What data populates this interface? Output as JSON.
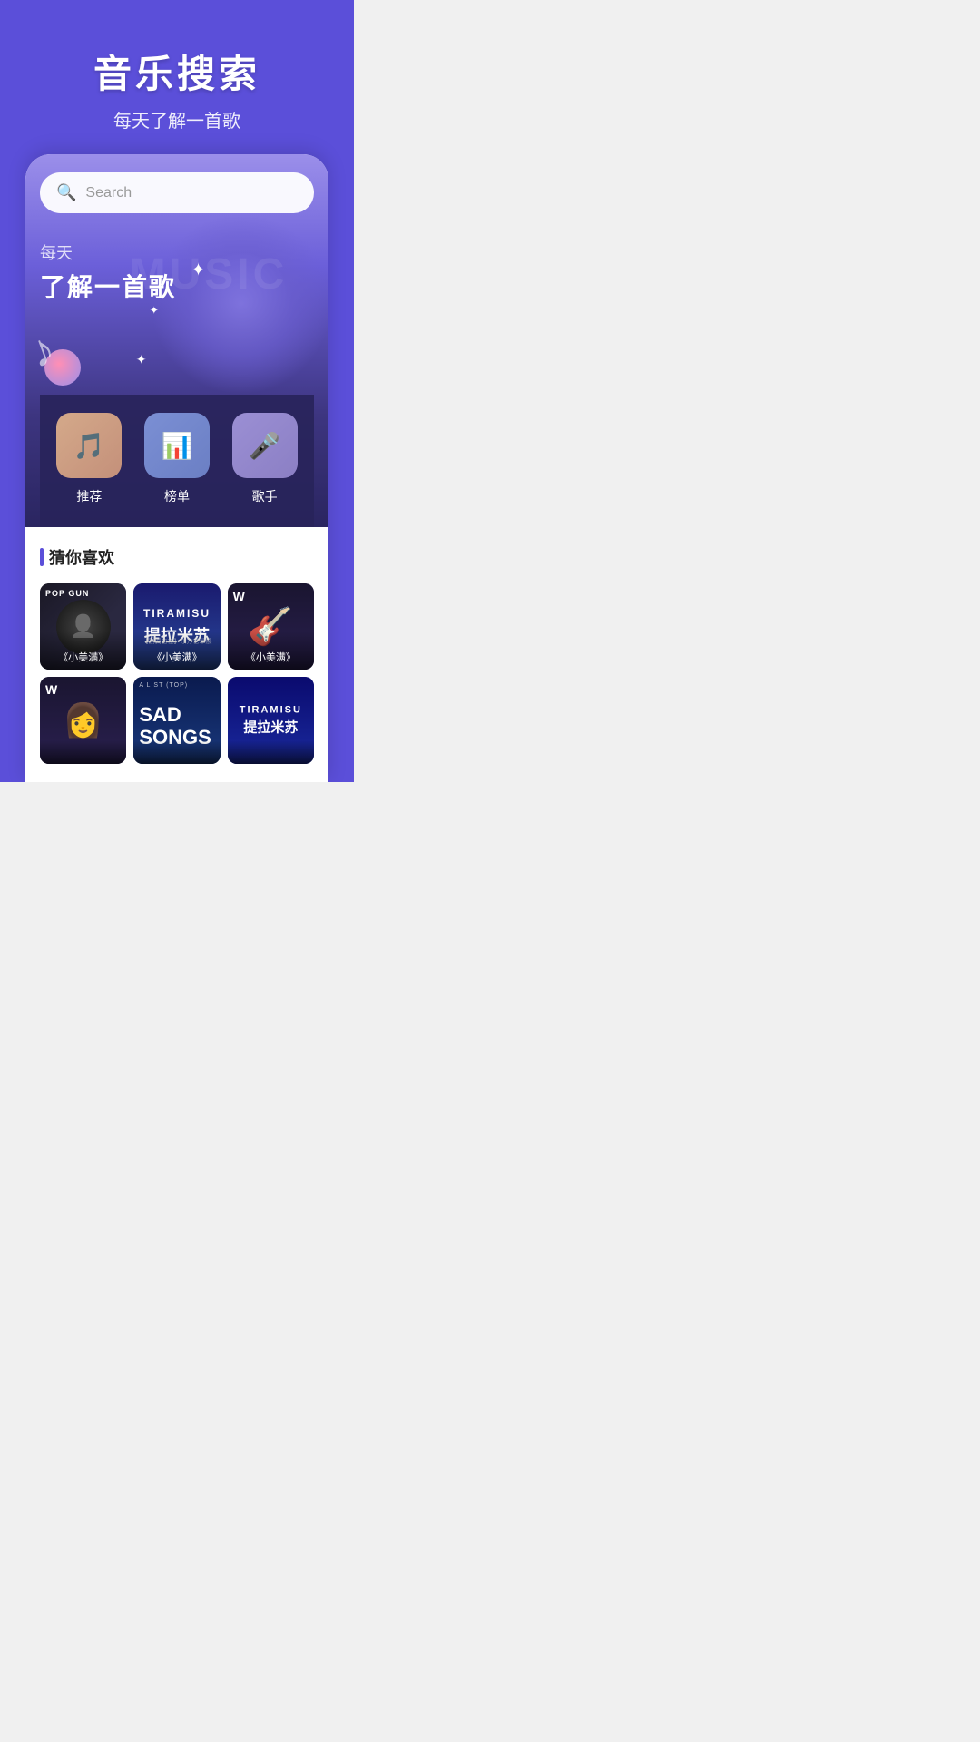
{
  "header": {
    "title": "音乐搜索",
    "subtitle": "每天了解一首歌"
  },
  "search": {
    "placeholder": "Search"
  },
  "banner": {
    "line1": "每天",
    "line2": "了解一首歌",
    "watermark": "MUSIC"
  },
  "quickAccess": {
    "items": [
      {
        "label": "推荐",
        "icon": "🎵"
      },
      {
        "label": "榜单",
        "icon": "📊"
      },
      {
        "label": "歌手",
        "icon": "🎤"
      }
    ]
  },
  "recommendSection": {
    "title": "猜你喜欢",
    "songs": [
      {
        "title": "《小美满》",
        "topLabel": "POP GUN",
        "type": "popgun"
      },
      {
        "title": "《小美满》",
        "topLabel": "TIRAMISU",
        "mainLabel": "提拉米苏",
        "type": "tiramisu"
      },
      {
        "title": "《小美满》",
        "topLabel": "W",
        "type": "artist"
      },
      {
        "title": "",
        "topLabel": "W",
        "type": "w"
      },
      {
        "title": "",
        "topLabel": "SAD SONGS",
        "type": "sad"
      },
      {
        "title": "",
        "topLabel": "TIRAMISU",
        "mainLabel": "提拉米苏",
        "type": "tiramisu2"
      }
    ]
  }
}
